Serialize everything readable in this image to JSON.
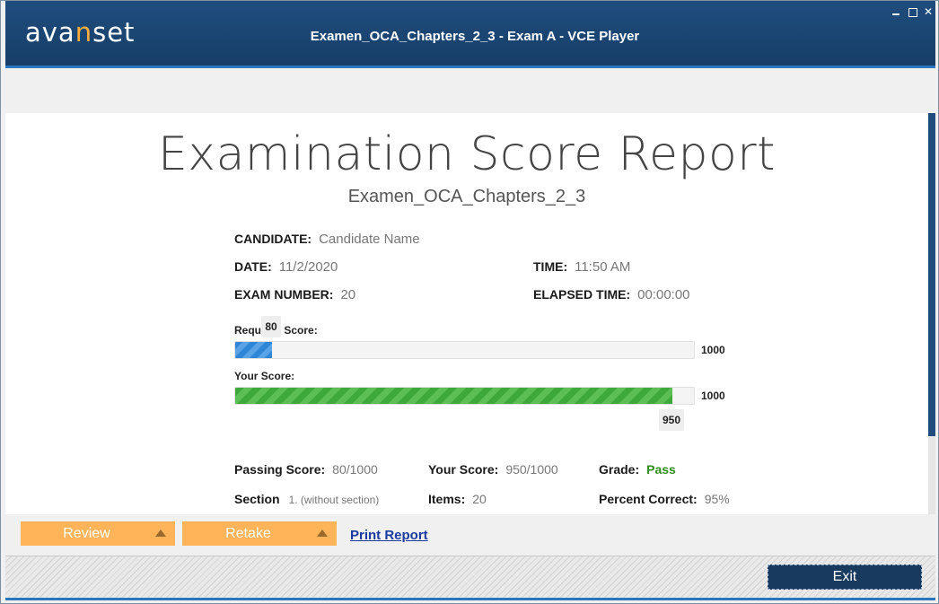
{
  "app": {
    "logo_text_a": "ava",
    "logo_text_n": "n",
    "logo_text_b": "set",
    "window_title": "Examen_OCA_Chapters_2_3 - Exam A - VCE Player",
    "close_glyph": "✕"
  },
  "report": {
    "title": "Examination Score Report",
    "subtitle": "Examen_OCA_Chapters_2_3",
    "candidate_label": "CANDIDATE:",
    "candidate_value": "Candidate Name",
    "date_label": "DATE:",
    "date_value": "11/2/2020",
    "time_label": "TIME:",
    "time_value": "11:50 AM",
    "exam_number_label": "EXAM NUMBER:",
    "exam_number_value": "20",
    "elapsed_label": "ELAPSED TIME:",
    "elapsed_value": "00:00:00",
    "required_score_label": "Required Score:",
    "required_score": 80,
    "required_score_text": "80",
    "your_score_bar_label": "Your Score:",
    "your_score": 950,
    "your_score_text": "950",
    "max_score": 1000,
    "max_score_text": "1000",
    "passing_score_label": "Passing Score:",
    "passing_score_value": "80/1000",
    "your_score_label": "Your Score:",
    "your_score_value": "950/1000",
    "grade_label": "Grade:",
    "grade_value": "Pass",
    "section_label": "Section",
    "section_value": "1. (without section)",
    "items_label": "Items:",
    "items_value": "20",
    "percent_label": "Percent Correct:",
    "percent_value": "95%"
  },
  "toolbar": {
    "review_label": "Review",
    "retake_label": "Retake",
    "print_label": "Print Report"
  },
  "footer": {
    "exit_label": "Exit"
  },
  "colors": {
    "titlebar": "#1f4d7e",
    "accent_orange": "#ffb45a",
    "pass_green": "#2f8f1f",
    "required_bar": "#2f86d6",
    "score_bar": "#3ea83a"
  }
}
